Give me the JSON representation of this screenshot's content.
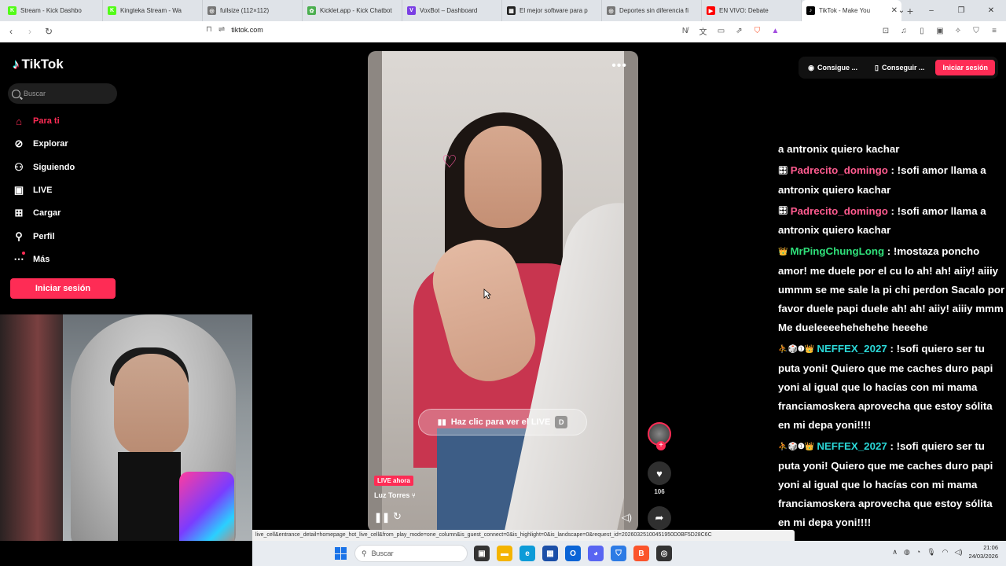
{
  "browser": {
    "tabs": [
      {
        "label": "Stream - Kick Dashbo",
        "fav": "K",
        "color": "#53fc18"
      },
      {
        "label": "Kingteka Stream - Wa",
        "fav": "K",
        "color": "#53fc18"
      },
      {
        "label": "fullsize (112×112)",
        "fav": "◎",
        "color": "#777777"
      },
      {
        "label": "Kicklet.app - Kick Chatbot",
        "fav": "✿",
        "color": "#4caf50"
      },
      {
        "label": "VoxBot – Dashboard",
        "fav": "V",
        "color": "#7b3fe4"
      },
      {
        "label": "El mejor software para p",
        "fav": "▦",
        "color": "#222222"
      },
      {
        "label": "Deportes sin diferencia fi",
        "fav": "◎",
        "color": "#777777"
      },
      {
        "label": "EN VIVO: Debate",
        "fav": "▶",
        "color": "#ff0000"
      },
      {
        "label": "TikTok - Make You",
        "fav": "♪",
        "color": "#000000"
      }
    ],
    "url": "tiktok.com"
  },
  "sidebar": {
    "logo": "TikTok",
    "search_placeholder": "Buscar",
    "items": [
      {
        "label": "Para ti",
        "icon": "home-icon"
      },
      {
        "label": "Explorar",
        "icon": "compass-icon"
      },
      {
        "label": "Siguiendo",
        "icon": "following-icon"
      },
      {
        "label": "LIVE",
        "icon": "live-icon"
      },
      {
        "label": "Cargar",
        "icon": "upload-icon"
      },
      {
        "label": "Perfil",
        "icon": "profile-icon"
      },
      {
        "label": "Más",
        "icon": "more-icon"
      }
    ],
    "login": "Iniciar sesión"
  },
  "topbar": {
    "btn1": "Consigue ...",
    "btn2": "Conseguir ...",
    "signin": "Iniciar sesión"
  },
  "video": {
    "cta": "Haz clic para ver el LIVE",
    "cta_key": "D",
    "live_badge": "LIVE ahora",
    "username": "Luz Torres",
    "like_count": "106",
    "share_count": "2"
  },
  "chat": [
    {
      "badge": "",
      "user": "",
      "color": "",
      "text": "a antronix quiero kachar"
    },
    {
      "badge": "🎛",
      "user": "Padrecito_domingo",
      "color": "u-pink",
      "text": " : !sofi amor llama a antronix quiero kachar"
    },
    {
      "badge": "🎛",
      "user": "Padrecito_domingo",
      "color": "u-pink",
      "text": " : !sofi amor llama a antronix quiero kachar"
    },
    {
      "badge": "👑",
      "user": "MrPingChungLong",
      "color": "u-green",
      "text": " : !mostaza poncho amor! me duele por el cu lo ah! ah! aiiy! aiiiy ummm se me sale la pi chi perdon Sacalo por favor duele papi duele ah! ah! aiiy! aiiiy mmm Me dueleeeehehehehe heeehe"
    },
    {
      "badge": "⛹🎲❶👑",
      "user": "NEFFEX_2027",
      "color": "u-cyan",
      "text": " : !sofi quiero ser tu puta yoni! Quiero que me caches duro papi yoni al igual que lo hacías con mi mama franciamoskera aprovecha que estoy sólita en mi depa yoni!!!!"
    },
    {
      "badge": "⛹🎲❶👑",
      "user": "NEFFEX_2027",
      "color": "u-cyan",
      "text": " : !sofi quiero ser tu puta yoni! Quiero que me caches duro papi yoni al igual que lo hacías con mi mama franciamoskera aprovecha que estoy sólita en mi depa yoni!!!!"
    }
  ],
  "status_url": "live_cell&entrance_detail=homepage_hot_live_cell&from_play_mode=one_column&is_guest_connect=0&is_highlight=0&is_landscape=0&request_id=20260325100451950D0BF5D28C6C",
  "taskbar": {
    "search": "Buscar",
    "time": "21:06",
    "date": "24/03/2026"
  }
}
